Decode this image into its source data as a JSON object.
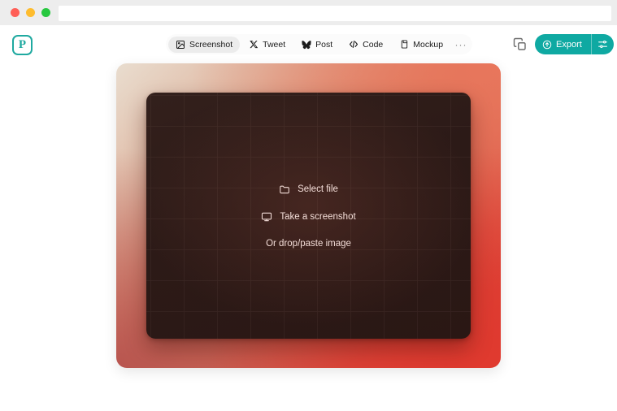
{
  "window": {
    "traffic_lights": [
      {
        "name": "close",
        "color": "#ff5f57"
      },
      {
        "name": "minimize",
        "color": "#febc2e"
      },
      {
        "name": "maximize",
        "color": "#28c840"
      }
    ],
    "address_bar_value": ""
  },
  "app": {
    "logo_letter": "P",
    "brand_color": "#1fa9a0"
  },
  "toolbar": {
    "tabs": [
      {
        "label": "Screenshot",
        "icon": "image-icon",
        "active": true
      },
      {
        "label": "Tweet",
        "icon": "x-twitter-icon",
        "active": false
      },
      {
        "label": "Post",
        "icon": "bluesky-butterfly-icon",
        "active": false
      },
      {
        "label": "Code",
        "icon": "code-brackets-icon",
        "active": false
      },
      {
        "label": "Mockup",
        "icon": "device-mockup-icon",
        "active": false
      }
    ],
    "more_label": "···",
    "copy_label": "Copy",
    "export_label": "Export",
    "export_settings_label": "Export settings",
    "export_color": "#0fa9a2"
  },
  "canvas": {
    "gradient": {
      "top_left": "#e9ddcf",
      "top_right": "#e8765c",
      "bottom_left": "#b8554f",
      "bottom_right": "#d9372e"
    },
    "panel_color": "#2c1a17",
    "actions": [
      {
        "label": "Select file",
        "icon": "folder-icon"
      },
      {
        "label": "Take a screenshot",
        "icon": "monitor-icon"
      }
    ],
    "hint": "Or drop/paste image"
  }
}
